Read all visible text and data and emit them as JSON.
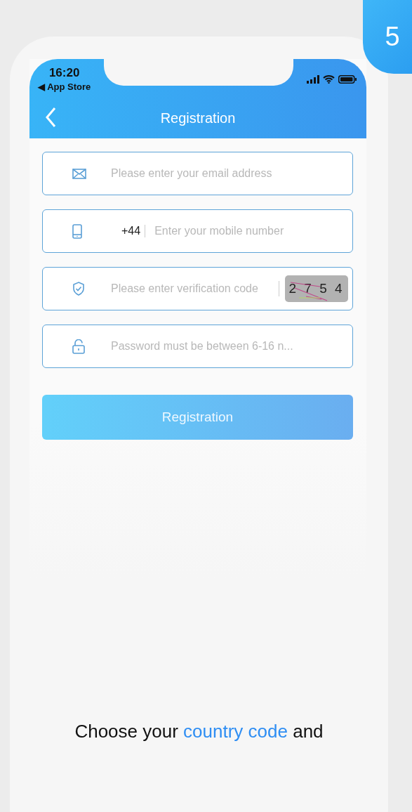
{
  "badge": "5",
  "status_bar": {
    "time": "16:20",
    "back_app": "◀ App Store"
  },
  "nav": {
    "title": "Registration"
  },
  "fields": [
    {
      "kind": "email",
      "placeholder": "Please enter your email address"
    },
    {
      "kind": "phone",
      "prefix": "+44",
      "placeholder": "Enter your mobile number"
    },
    {
      "kind": "code",
      "placeholder": "Please enter verification code",
      "captcha": "2 7 5 4"
    },
    {
      "kind": "password",
      "placeholder": "Password must be between 6-16 n..."
    }
  ],
  "submit": "Registration",
  "caption": [
    {
      "text": "Choose your ",
      "highlight": false
    },
    {
      "text": "country code",
      "highlight": true
    },
    {
      "text": " and",
      "highlight": false
    }
  ]
}
